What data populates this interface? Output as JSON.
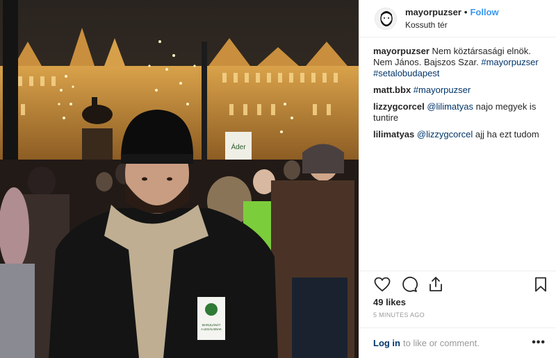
{
  "post": {
    "username": "mayorpuzser",
    "separator": "•",
    "follow_label": "Follow",
    "location": "Kossuth tér"
  },
  "comments": [
    {
      "user": "mayorpuzser",
      "text": "Nem köztársasági elnök. Nem János. Bajszos Szar.",
      "tags": "#mayorpuzser #setalobudapest"
    },
    {
      "user": "matt.bbx",
      "text": "",
      "tags": "#mayorpuzser"
    },
    {
      "user": "lizzygcorcel",
      "mention": "@lilimatyas",
      "text": "najo megyek is tuntire"
    },
    {
      "user": "lilimatyas",
      "mention": "@lizzygcorcel",
      "text": "ajj ha ezt tudom"
    }
  ],
  "actions": {
    "like_icon": "heart-icon",
    "comment_icon": "comment-icon",
    "share_icon": "share-icon",
    "save_icon": "bookmark-icon"
  },
  "likes": "49 likes",
  "timestamp": "5 MINUTES AGO",
  "login": {
    "link": "Log in",
    "rest": "to like or comment.",
    "more_label": "•••"
  },
  "photo": {
    "protest_sign": "Áder",
    "badge_line1": "MARIJUÁNÁT",
    "badge_line2": "A LEGÁLISNAK"
  },
  "colors": {
    "accent": "#3897f0",
    "link": "#003569",
    "muted": "#999999",
    "text": "#262626"
  }
}
